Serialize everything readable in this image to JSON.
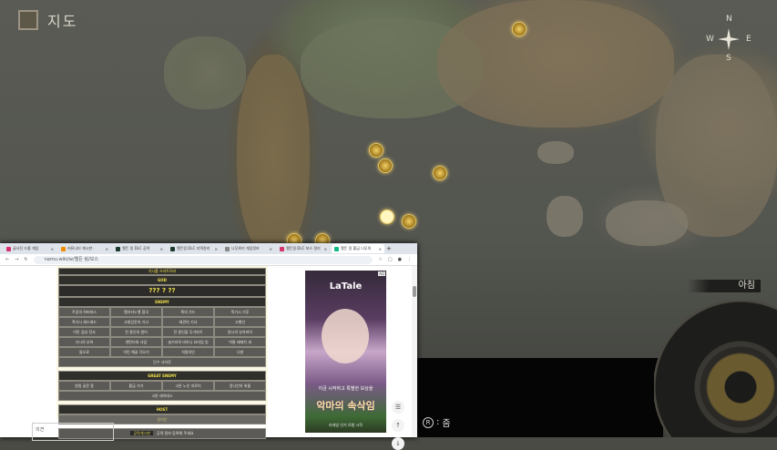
{
  "game": {
    "title": "지도",
    "time_of_day": "아침",
    "zoom_hint_key": "R",
    "zoom_hint_label": "줌",
    "compass": [
      "N",
      "S",
      "W",
      "E"
    ],
    "map_icon": "map-icon"
  },
  "browser": {
    "tabs": [
      {
        "label": "글사진 드롭 게임",
        "color": "#d6336c"
      },
      {
        "label": "커뮤니티 게시판 -",
        "color": "#f08c00"
      },
      {
        "label": "엘든 링 DLC 공략",
        "color": "#1b3a2b"
      },
      {
        "label": "엘든링 DLC 지역정리",
        "color": "#1b3a2b"
      },
      {
        "label": "나무위키 게임정보",
        "color": "#888888"
      },
      {
        "label": "엘든링 DLC 보스 정리",
        "color": "#d6336c"
      },
      {
        "label": "엘든 링 황금 나무의",
        "color": "#12b886",
        "active": true
      }
    ],
    "url": "namu.wiki/w/엘든 링/보스",
    "new_tab": "+"
  },
  "boss_table": {
    "caption": "가시를 쓰러트려라",
    "god_header": "GOD",
    "god_value": "??? ? ??",
    "enemy_header": "ENEMY",
    "enemy_rows": [
      [
        "주검의 하버파스",
        "엘리자누엘 협곡",
        "흑의 가드",
        "폭가시 거루"
      ],
      [
        "폭가시 헤드레드",
        "고발갑옷의 기사",
        "제관의 기사",
        "고행인"
      ],
      [
        "이민 검성 전사",
        "전 용인의 원어",
        "전 용인을 무기마이",
        "원시의 부하마이"
      ],
      [
        "가시의 부하",
        "엔탄타와 사업",
        "술기러의 바카니 요마업 킹",
        "빅물 태재치 새"
      ],
      [
        "들오료",
        "이민 해골 각오기",
        "석령의인",
        "나발"
      ]
    ],
    "enemy_last": "단수 사마루",
    "great_enemy_header": "GREAT ENEMY",
    "great_enemy_rows": [
      [
        "영원 골문 용",
        "황금 가가",
        "고룬 노인 미로이",
        "몽니언의 위롬"
      ]
    ],
    "great_enemy_last": "고룬 레어데스",
    "host_header": "HOST",
    "host_value": "광의안",
    "footer_badge": "공략게시판",
    "footer_text": "공략 정보 등록해 주세요"
  },
  "comment_box": "의견",
  "ad": {
    "logo": "LaTale",
    "slogan": "지금 시작하고 특별한 보상을",
    "title": "악마의 속삭임",
    "sub": "라테일 인기 모험 시작",
    "close": "AD"
  },
  "side_buttons": [
    "☰",
    "↑",
    "↓"
  ]
}
